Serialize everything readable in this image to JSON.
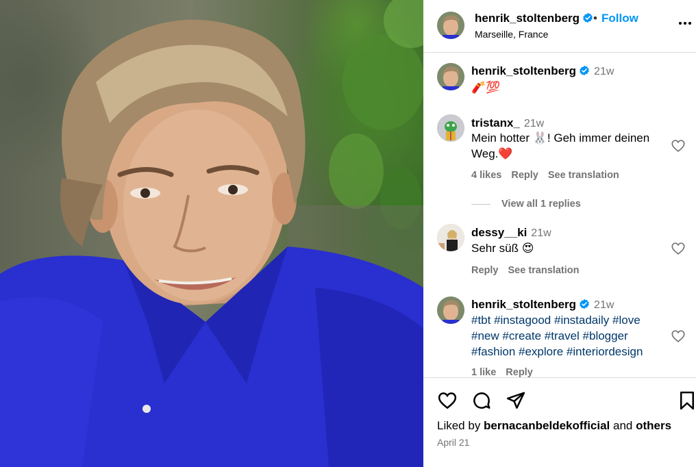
{
  "post": {
    "author": "henrik_stoltenberg",
    "location": "Marseille, France",
    "follow_label": "Follow",
    "dot": "•",
    "liked_prefix": "Liked by ",
    "liked_user": "bernacanbeldekofficial",
    "liked_and": " and ",
    "liked_others": "others",
    "date": "April 21"
  },
  "comments": [
    {
      "user": "henrik_stoltenberg",
      "verified": true,
      "time": "21w",
      "text": "🧨💯"
    },
    {
      "user": "tristanx_",
      "verified": false,
      "time": "21w",
      "text": "Mein hotter 🐰! Geh immer deinen Weg.❤️",
      "likes": "4 likes",
      "reply": "Reply",
      "translate": "See translation",
      "view_replies": "View all 1 replies"
    },
    {
      "user": "dessy__ki",
      "verified": false,
      "time": "21w",
      "text": "Sehr süß 😍",
      "reply": "Reply",
      "translate": "See translation"
    },
    {
      "user": "henrik_stoltenberg",
      "verified": true,
      "time": "21w",
      "hashtags": "#tbt #instagood #instadaily #love #new #create #travel #blogger #fashion #explore #interiordesign",
      "likes": "1 like",
      "reply": "Reply"
    }
  ],
  "icons": {
    "more": "more-options-icon",
    "like": "heart-icon",
    "comment": "comment-icon",
    "share": "share-icon",
    "save": "bookmark-icon",
    "verified": "verified-badge-icon"
  },
  "colors": {
    "accent": "#0095f6",
    "verified": "#0095f6",
    "hashtag": "#00376b",
    "secondary_text": "#737373",
    "shirt": "#2a2fd0"
  }
}
